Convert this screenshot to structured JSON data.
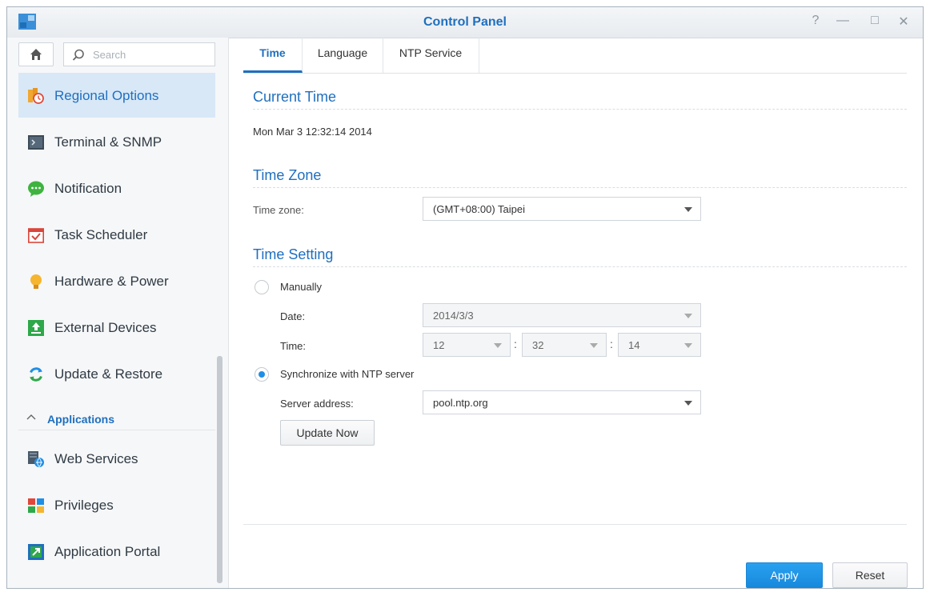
{
  "window": {
    "title": "Control Panel",
    "controls": {
      "help": "?",
      "minimize": "—",
      "maximize": "□",
      "close": "✕"
    }
  },
  "sidebar": {
    "search_placeholder": "Search",
    "items": [
      {
        "label": "Regional Options",
        "icon": "regional-options-icon",
        "active": true
      },
      {
        "label": "Terminal & SNMP",
        "icon": "terminal-icon"
      },
      {
        "label": "Notification",
        "icon": "notification-icon"
      },
      {
        "label": "Task Scheduler",
        "icon": "task-scheduler-icon"
      },
      {
        "label": "Hardware & Power",
        "icon": "hardware-power-icon"
      },
      {
        "label": "External Devices",
        "icon": "external-devices-icon"
      },
      {
        "label": "Update & Restore",
        "icon": "update-restore-icon"
      }
    ],
    "section": {
      "label": "Applications",
      "arrow": "^"
    },
    "app_items": [
      {
        "label": "Web Services",
        "icon": "web-services-icon"
      },
      {
        "label": "Privileges",
        "icon": "privileges-icon"
      },
      {
        "label": "Application Portal",
        "icon": "application-portal-icon"
      }
    ]
  },
  "tabs": [
    "Time",
    "Language",
    "NTP Service"
  ],
  "main": {
    "current_time": {
      "title": "Current Time",
      "value": "Mon Mar 3 12:32:14 2014"
    },
    "time_zone": {
      "title": "Time Zone",
      "label": "Time zone:",
      "value": "(GMT+08:00) Taipei"
    },
    "time_setting": {
      "title": "Time Setting",
      "manual_label": "Manually",
      "date_label": "Date:",
      "date_value": "2014/3/3",
      "time_label": "Time:",
      "hour": "12",
      "minute": "32",
      "second": "14",
      "separator": ":",
      "ntp_label": "Synchronize with NTP server",
      "server_label": "Server address:",
      "server_value": "pool.ntp.org",
      "update_button": "Update Now"
    }
  },
  "footer": {
    "apply": "Apply",
    "reset": "Reset"
  },
  "colors": {
    "accent": "#1f6fbf",
    "primary_button": "#1f8fe6",
    "active_nav": "#d8e8f7"
  }
}
